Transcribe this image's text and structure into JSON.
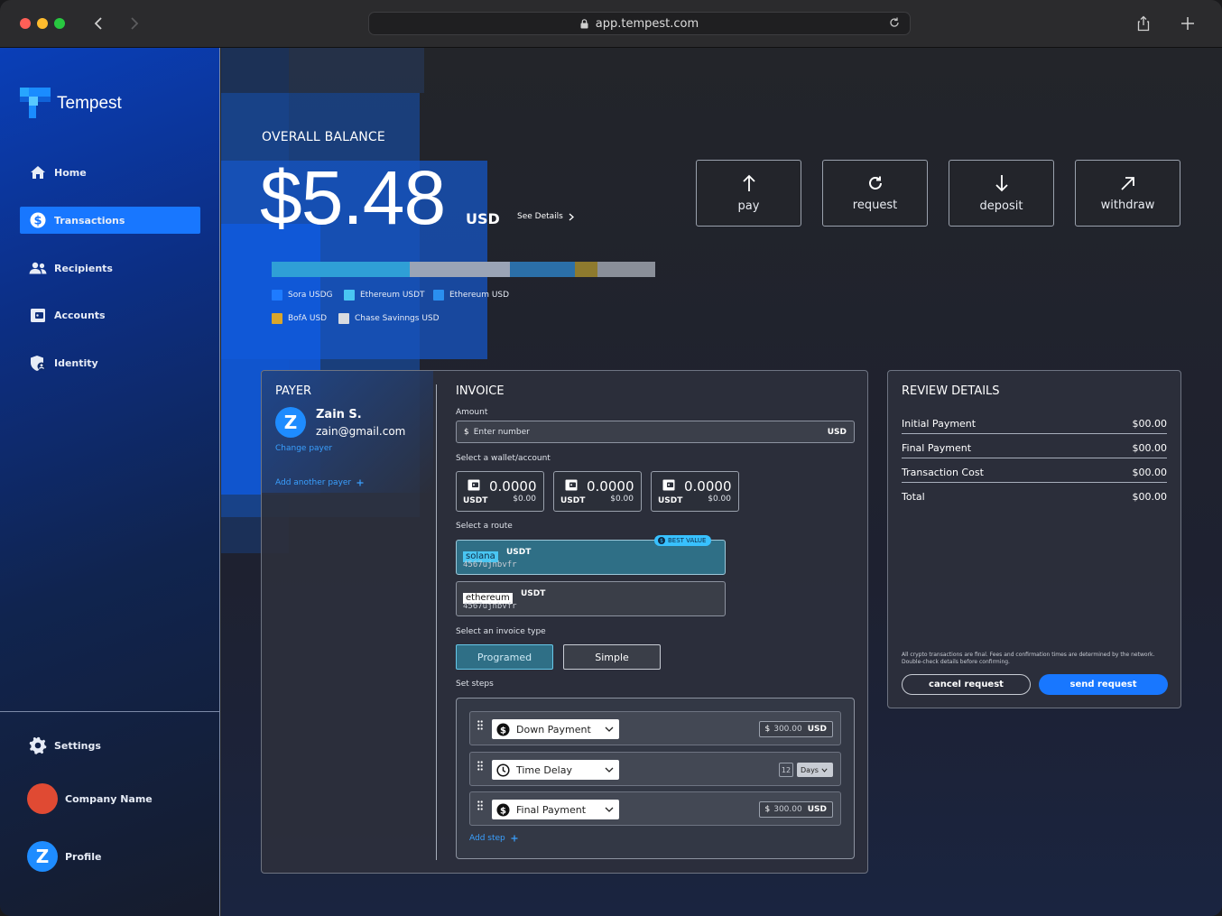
{
  "browser": {
    "url": "app.tempest.com"
  },
  "app": {
    "name": "Tempest"
  },
  "sidebar": {
    "items": [
      {
        "label": "Home",
        "icon": "home-icon"
      },
      {
        "label": "Transactions",
        "icon": "dollar-icon",
        "active": true
      },
      {
        "label": "Recipients",
        "icon": "users-icon"
      },
      {
        "label": "Accounts",
        "icon": "wallet-icon"
      },
      {
        "label": "Identity",
        "icon": "shield-user-icon"
      }
    ],
    "settings_label": "Settings",
    "company_label": "Company Name",
    "profile_label": "Profile",
    "profile_initial": "Z"
  },
  "balance": {
    "label": "OVERALL BALANCE",
    "amount": "$5.48",
    "currency": "USD",
    "see_details": "See Details",
    "allocation": [
      {
        "name": "Sora USDG",
        "color": "#1e7bff",
        "fraction": 0.0
      },
      {
        "name": "Ethereum USDT",
        "color": "#2f9fd6",
        "fraction": 0.36
      },
      {
        "name": "Chase Savinngs USD",
        "color": "#9aa4b6",
        "fraction": 0.26
      },
      {
        "name": "Ethereum USD",
        "color": "#2b6fa8",
        "fraction": 0.17
      },
      {
        "name": "BofA USD",
        "color": "#8e7a2e",
        "fraction": 0.06
      },
      {
        "name": "Chase Savinngs USD",
        "color": "#8a8f99",
        "fraction": 0.15
      }
    ],
    "legend": [
      {
        "name": "Sora USDG",
        "color": "#1e7bff"
      },
      {
        "name": "Ethereum USDT",
        "color": "#49c6f2"
      },
      {
        "name": "Ethereum USD",
        "color": "#2a8ff0"
      },
      {
        "name": "BofA USD",
        "color": "#d9a62b"
      },
      {
        "name": "Chase Savinngs USD",
        "color": "#d8dbe0"
      }
    ]
  },
  "actions": [
    {
      "label": "pay",
      "icon": "arrow-up-icon"
    },
    {
      "label": "request",
      "icon": "refresh-icon"
    },
    {
      "label": "deposit",
      "icon": "arrow-down-icon"
    },
    {
      "label": "withdraw",
      "icon": "arrow-up-right-icon"
    }
  ],
  "payer": {
    "title": "PAYER",
    "initial": "Z",
    "name": "Zain S.",
    "email": "zain@gmail.com",
    "change_label": "Change payer",
    "add_label": "Add another payer"
  },
  "invoice": {
    "title": "INVOICE",
    "amount_label": "Amount",
    "amount_prefix": "$",
    "amount_placeholder": "Enter number",
    "amount_currency": "USD",
    "wallet_label": "Select a wallet/account",
    "wallets": [
      {
        "value": "0.0000",
        "token": "USDT",
        "usd": "$0.00"
      },
      {
        "value": "0.0000",
        "token": "USDT",
        "usd": "$0.00"
      },
      {
        "value": "0.0000",
        "token": "USDT",
        "usd": "$0.00"
      }
    ],
    "route_label": "Select a route",
    "routes": [
      {
        "chain": "solana",
        "token": "USDT",
        "address": "4567ujnbvfr",
        "badge": "BEST VALUE"
      },
      {
        "chain": "ethereum",
        "token": "USDT",
        "address": "4567ujnbvfr"
      }
    ],
    "type_label": "Select an invoice type",
    "types": [
      "Programed",
      "Simple"
    ],
    "steps_label": "Set steps",
    "steps": [
      {
        "name": "Down Payment",
        "icon": "dollar-icon",
        "prefix": "$",
        "amount": "300.00",
        "unit": "USD"
      },
      {
        "name": "Time Delay",
        "icon": "clock-icon",
        "count": "12",
        "unit": "Days"
      },
      {
        "name": "Final Payment",
        "icon": "dollar-icon",
        "prefix": "$",
        "amount": "300.00",
        "unit": "USD"
      }
    ],
    "add_step_label": "Add step"
  },
  "review": {
    "title": "REVIEW DETAILS",
    "rows": [
      {
        "label": "Initial Payment",
        "value": "$00.00"
      },
      {
        "label": "Final Payment",
        "value": "$00.00"
      },
      {
        "label": "Transaction Cost",
        "value": "$00.00"
      },
      {
        "label": "Total",
        "value": "$00.00"
      }
    ],
    "disclaimer": "All crypto transactions are final. Fees and confirmation times are determined by the network. Double-check details before confirming.",
    "cancel_label": "cancel request",
    "send_label": "send request"
  }
}
